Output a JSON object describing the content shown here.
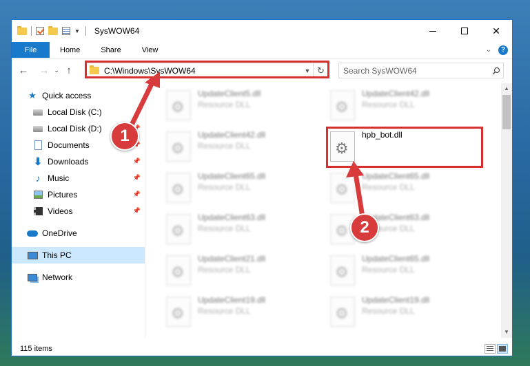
{
  "window": {
    "title": "SysWOW64",
    "controls": {
      "minimize": "—",
      "close": "✕"
    }
  },
  "ribbon": {
    "tabs": [
      "File",
      "Home",
      "Share",
      "View"
    ],
    "help_label": "?"
  },
  "navigation": {
    "back": "←",
    "forward": "→",
    "recent": "⌄",
    "up": "↑",
    "address": "C:\\Windows\\SysWOW64",
    "refresh": "↻",
    "search_placeholder": "Search SysWOW64"
  },
  "sidebar": {
    "items": [
      {
        "label": "Quick access",
        "icon": "star-icon",
        "pinned": false
      },
      {
        "label": "Local Disk (C:)",
        "icon": "drive-icon",
        "pinned": false
      },
      {
        "label": "Local Disk (D:)",
        "icon": "drive-icon",
        "pinned": true
      },
      {
        "label": "Documents",
        "icon": "document-icon",
        "pinned": true
      },
      {
        "label": "Downloads",
        "icon": "download-icon",
        "pinned": true
      },
      {
        "label": "Music",
        "icon": "music-icon",
        "pinned": true
      },
      {
        "label": "Pictures",
        "icon": "pictures-icon",
        "pinned": true
      },
      {
        "label": "Videos",
        "icon": "videos-icon",
        "pinned": true
      },
      {
        "label": "OneDrive",
        "icon": "cloud-icon",
        "pinned": false
      },
      {
        "label": "This PC",
        "icon": "computer-icon",
        "pinned": false,
        "selected": true
      },
      {
        "label": "Network",
        "icon": "network-icon",
        "pinned": false
      }
    ]
  },
  "files": [
    {
      "name": "UpdateClient5.dll",
      "type": "Resource DLL",
      "blurred": true
    },
    {
      "name": "UpdateClient42.dll",
      "type": "Resource DLL",
      "blurred": true
    },
    {
      "name": "UpdateClient42.dll",
      "type": "Resource DLL",
      "blurred": true
    },
    {
      "name": "hpb_bot.dll",
      "type": "",
      "blurred": false,
      "highlighted": true
    },
    {
      "name": "UpdateClient65.dll",
      "type": "Resource DLL",
      "blurred": true
    },
    {
      "name": "UpdateClient65.dll",
      "type": "Resource DLL",
      "blurred": true
    },
    {
      "name": "UpdateClient63.dll",
      "type": "Resource DLL",
      "blurred": true
    },
    {
      "name": "UpdateClient63.dll",
      "type": "Resource DLL",
      "blurred": true
    },
    {
      "name": "UpdateClient21.dll",
      "type": "Resource DLL",
      "blurred": true
    },
    {
      "name": "UpdateClient65.dll",
      "type": "Resource DLL",
      "blurred": true
    },
    {
      "name": "UpdateClient19.dll",
      "type": "Resource DLL",
      "blurred": true
    },
    {
      "name": "UpdateClient19.dll",
      "type": "Resource DLL",
      "blurred": true
    }
  ],
  "status": {
    "item_count": "115 items"
  },
  "annotations": {
    "step1": "1",
    "step2": "2",
    "color": "#d72f2f"
  },
  "colors": {
    "accent": "#1979ca",
    "selection": "#cce8ff",
    "highlight": "#d72f2f"
  }
}
